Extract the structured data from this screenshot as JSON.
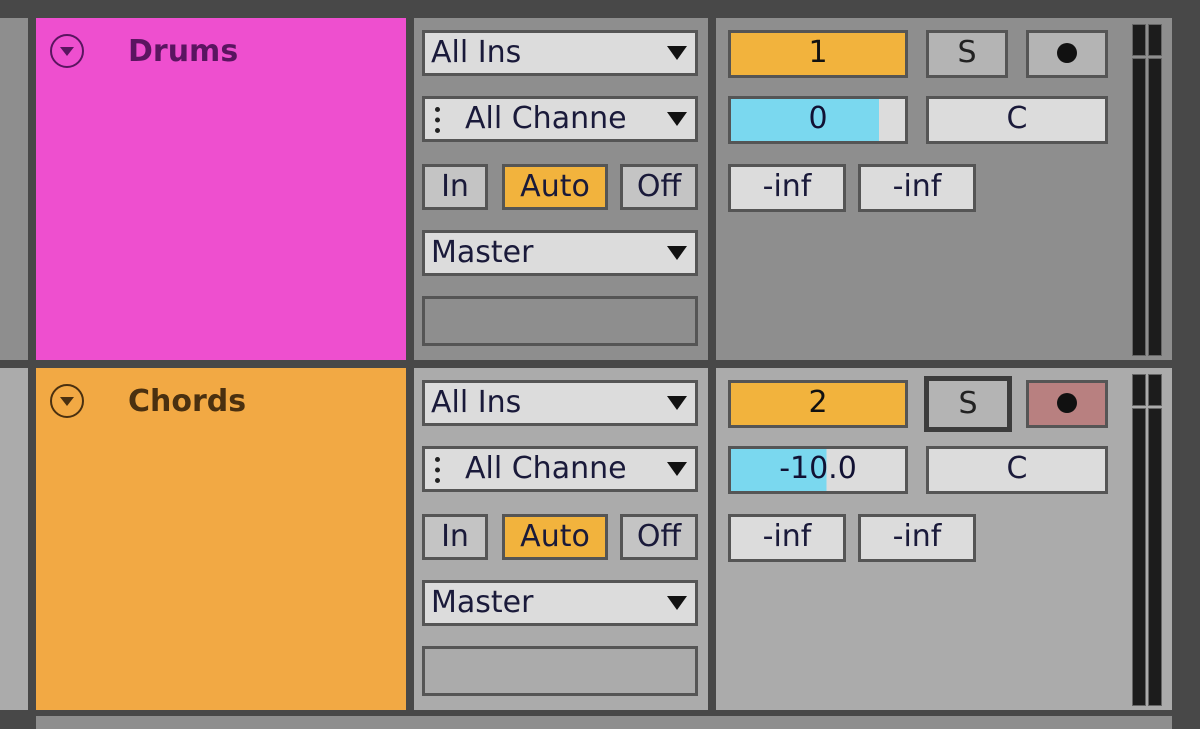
{
  "tracks": [
    {
      "name": "Drums",
      "color": "#ee4fcf",
      "text_color": "#5a1560",
      "input_type": "All Ins",
      "input_channel": "All Channe",
      "monitor": {
        "in": "In",
        "auto": "Auto",
        "off": "Off",
        "selected": "Auto"
      },
      "output": "Master",
      "track_number": "1",
      "solo": "S",
      "arm_icon": "record-arm-icon",
      "arm_active": false,
      "volume": "0",
      "volume_fill": 0.85,
      "pan": "C",
      "sends": [
        "-inf",
        "-inf"
      ]
    },
    {
      "name": "Chords",
      "color": "#f2a944",
      "text_color": "#4a3010",
      "input_type": "All Ins",
      "input_channel": "All Channe",
      "monitor": {
        "in": "In",
        "auto": "Auto",
        "off": "Off",
        "selected": "Auto"
      },
      "output": "Master",
      "track_number": "2",
      "solo": "S",
      "arm_icon": "record-arm-icon",
      "arm_active": true,
      "volume": "-10.0",
      "volume_fill": 0.55,
      "pan": "C",
      "sends": [
        "-inf",
        "-inf"
      ]
    }
  ],
  "colors": {
    "auto_active": "#f2b33d",
    "volume_fill": "#7ad8ef",
    "arm_active": "#b88080",
    "track_number": "#f2b33d"
  }
}
